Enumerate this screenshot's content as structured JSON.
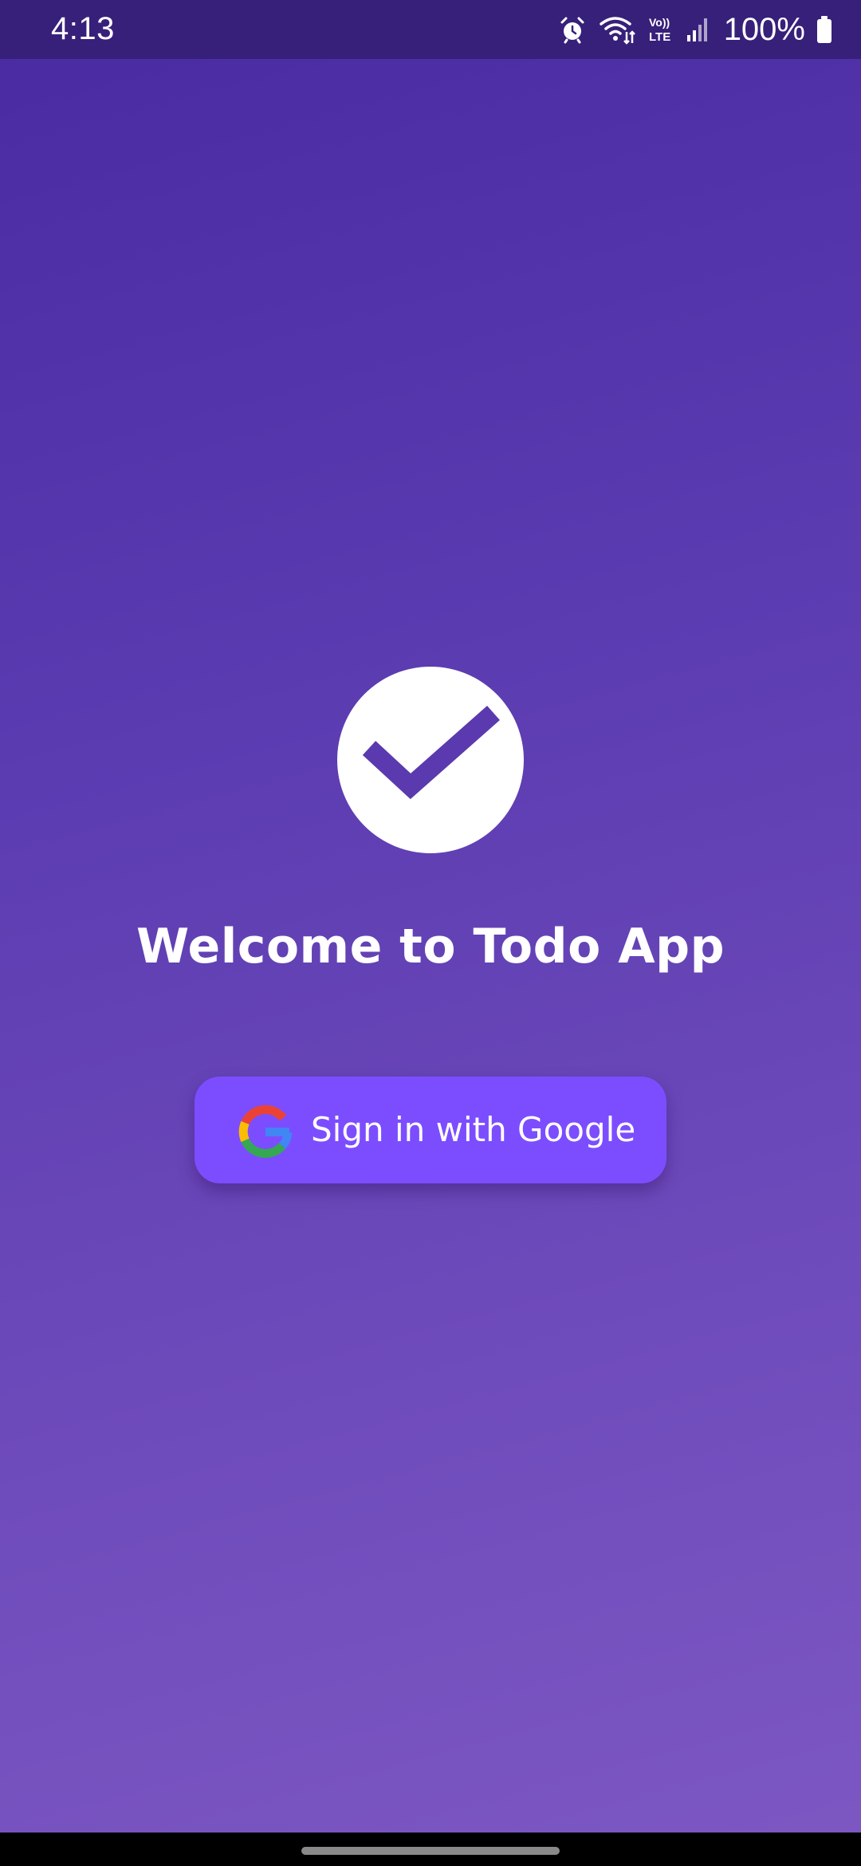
{
  "status_bar": {
    "time": "4:13",
    "battery_percent": "100%",
    "icons": [
      "alarm-icon",
      "wifi-icon",
      "volte-icon",
      "signal-icon",
      "battery-icon"
    ],
    "volte_label_top": "Vo))",
    "volte_label_bottom": "LTE"
  },
  "logo": {
    "icon": "check-circle-icon",
    "circle_color": "#ffffff",
    "check_color": "#5a3aae"
  },
  "welcome": {
    "title": "Welcome to Todo App"
  },
  "sign_in": {
    "label": "Sign in with Google",
    "icon": "google-icon",
    "button_color": "#7c4dff"
  },
  "colors": {
    "background_top": "#4a2aa1",
    "background_bottom": "#7d58c3",
    "status_bar": "#37207a"
  }
}
